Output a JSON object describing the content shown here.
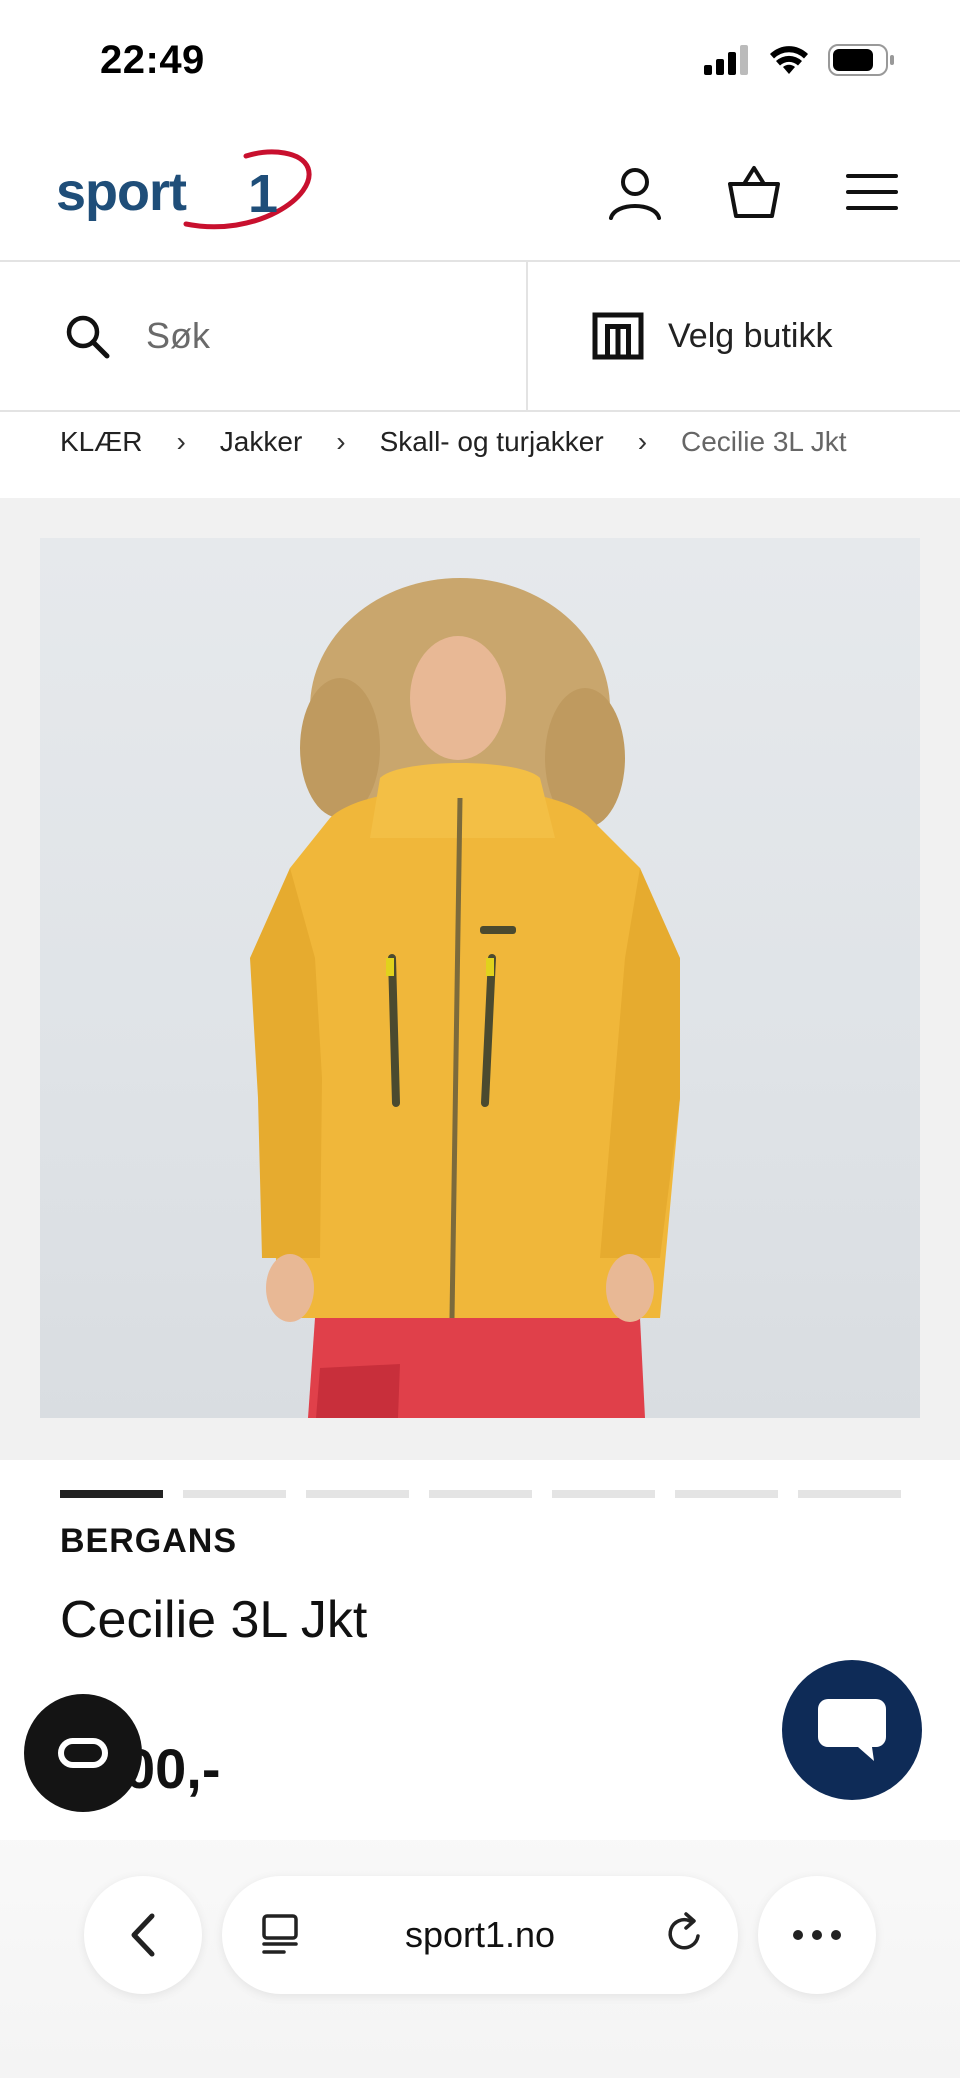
{
  "status_bar": {
    "time": "22:49"
  },
  "header": {
    "logo_text": "sport 1",
    "icons": [
      "user-icon",
      "basket-icon",
      "menu-icon"
    ]
  },
  "search": {
    "placeholder": "Søk",
    "store_label": "Velg butikk"
  },
  "breadcrumb": {
    "items": [
      "KLÆR",
      "Jakker",
      "Skall- og turjakker",
      "Cecilie 3L Jkt"
    ]
  },
  "gallery": {
    "image_count": 7,
    "active_index": 1
  },
  "product": {
    "brand": "BERGANS",
    "title": "Cecilie 3L Jkt",
    "price_visible": "00,-"
  },
  "browser": {
    "url": "sport1.no"
  },
  "colors": {
    "brand_blue": "#1f4e79",
    "brand_red": "#c8102e",
    "chat_button": "#0e2b57",
    "jacket": "#f0b73a"
  }
}
